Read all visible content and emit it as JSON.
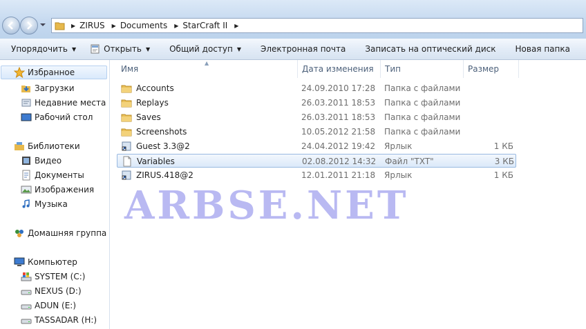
{
  "address": {
    "crumbs": [
      "ZIRUS",
      "Documents",
      "StarCraft II"
    ]
  },
  "toolbar": {
    "organize": "Упорядочить",
    "open": "Открыть",
    "share": "Общий доступ",
    "email": "Электронная почта",
    "burn": "Записать на оптический диск",
    "new_folder": "Новая папка"
  },
  "nav": {
    "favorites": "Избранное",
    "downloads": "Загрузки",
    "recent": "Недавние места",
    "desktop": "Рабочий стол",
    "libraries": "Библиотеки",
    "video": "Видео",
    "documents": "Документы",
    "pictures": "Изображения",
    "music": "Музыка",
    "homegroup": "Домашняя группа",
    "computer": "Компьютер",
    "drive_c": "SYSTEM (C:)",
    "drive_d": "NEXUS (D:)",
    "drive_e": "ADUN (E:)",
    "drive_h": "TASSADAR (H:)"
  },
  "columns": {
    "name": "Имя",
    "date": "Дата изменения",
    "type": "Тип",
    "size": "Размер"
  },
  "files": [
    {
      "name": "Accounts",
      "date": "24.09.2010 17:28",
      "type": "Папка с файлами",
      "size": "",
      "icon": "folder-icon"
    },
    {
      "name": "Replays",
      "date": "26.03.2011 18:53",
      "type": "Папка с файлами",
      "size": "",
      "icon": "folder-icon"
    },
    {
      "name": "Saves",
      "date": "26.03.2011 18:53",
      "type": "Папка с файлами",
      "size": "",
      "icon": "folder-icon"
    },
    {
      "name": "Screenshots",
      "date": "10.05.2012 21:58",
      "type": "Папка с файлами",
      "size": "",
      "icon": "folder-icon"
    },
    {
      "name": "Guest 3.3@2",
      "date": "24.04.2012 19:42",
      "type": "Ярлык",
      "size": "1 КБ",
      "icon": "shortcut-icon"
    },
    {
      "name": "Variables",
      "date": "02.08.2012 14:32",
      "type": "Файл \"TXT\"",
      "size": "3 КБ",
      "icon": "text-file-icon"
    },
    {
      "name": "ZIRUS.418@2",
      "date": "12.01.2011 21:18",
      "type": "Ярлык",
      "size": "1 КБ",
      "icon": "shortcut-icon"
    }
  ],
  "watermark": "ARBSE.NET"
}
